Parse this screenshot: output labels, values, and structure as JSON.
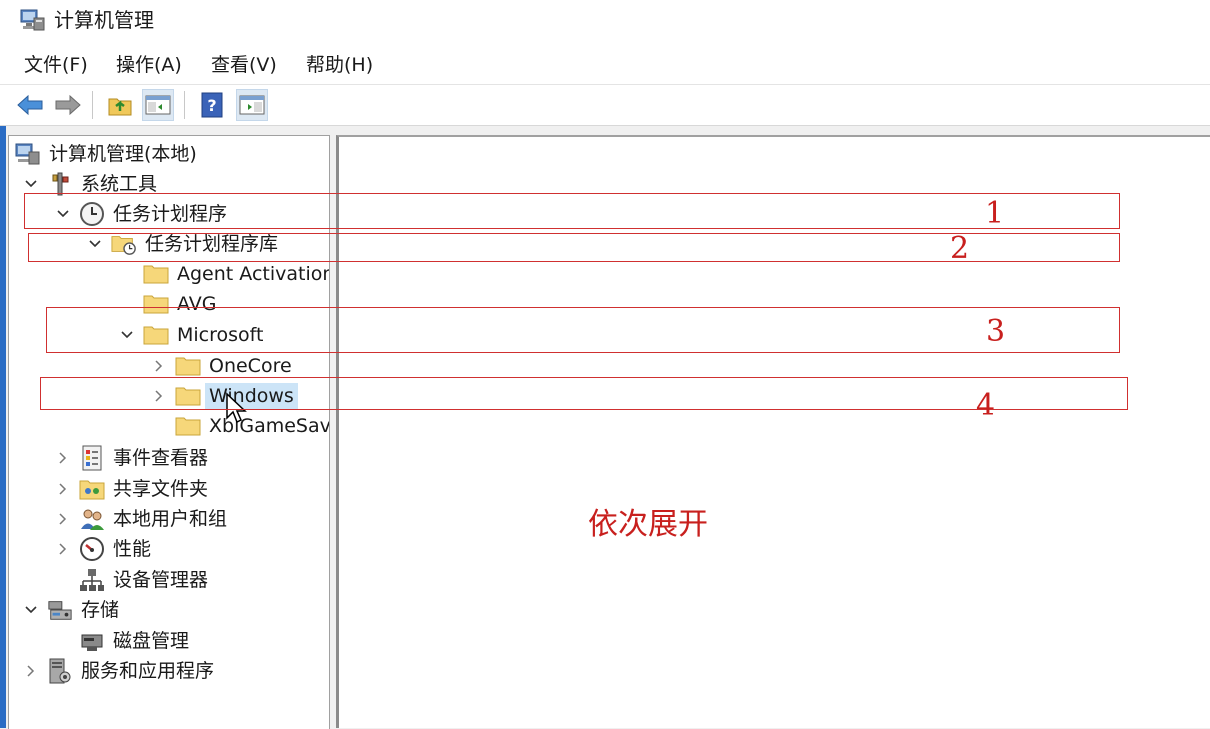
{
  "window": {
    "title": "计算机管理",
    "title_icon": "computer-management-icon"
  },
  "menu": {
    "items": [
      {
        "label": "文件(F)"
      },
      {
        "label": "操作(A)"
      },
      {
        "label": "查看(V)"
      },
      {
        "label": "帮助(H)"
      }
    ]
  },
  "toolbar": {
    "buttons": [
      {
        "icon": "back-arrow-icon"
      },
      {
        "icon": "forward-arrow-icon"
      },
      {
        "icon": "up-folder-icon"
      },
      {
        "icon": "show-hide-console-tree-icon"
      },
      {
        "icon": "help-icon"
      },
      {
        "icon": "show-hide-action-pane-icon"
      }
    ]
  },
  "tree": {
    "root": {
      "label": "计算机管理(本地)",
      "icon": "computer-management-icon"
    },
    "system_tools": {
      "label": "系统工具",
      "icon": "tools-icon"
    },
    "task_scheduler": {
      "label": "任务计划程序",
      "icon": "clock-icon"
    },
    "task_library": {
      "label": "任务计划程序库",
      "icon": "folder-clock-icon"
    },
    "agent_activation": {
      "label": "Agent Activation",
      "icon": "folder-icon"
    },
    "avg": {
      "label": "AVG",
      "icon": "folder-icon"
    },
    "microsoft": {
      "label": "Microsoft",
      "icon": "folder-icon"
    },
    "onecore": {
      "label": "OneCore",
      "icon": "folder-icon"
    },
    "windows": {
      "label": "Windows",
      "icon": "folder-icon"
    },
    "xblgamesave": {
      "label": "XblGameSave",
      "icon": "folder-icon"
    },
    "event_viewer": {
      "label": "事件查看器",
      "icon": "event-viewer-icon"
    },
    "shared_folders": {
      "label": "共享文件夹",
      "icon": "shared-folder-icon"
    },
    "local_users": {
      "label": "本地用户和组",
      "icon": "users-icon"
    },
    "performance": {
      "label": "性能",
      "icon": "performance-icon"
    },
    "device_manager": {
      "label": "设备管理器",
      "icon": "device-manager-icon"
    },
    "storage": {
      "label": "存储",
      "icon": "storage-icon"
    },
    "disk_management": {
      "label": "磁盘管理",
      "icon": "disk-icon"
    },
    "services_apps": {
      "label": "服务和应用程序",
      "icon": "services-icon"
    }
  },
  "annotations": {
    "numbers": [
      "1",
      "2",
      "3",
      "4"
    ],
    "caption": "依次展开",
    "color": "#c8201e"
  },
  "colors": {
    "selection": "#cce4f7",
    "folder": "#f6d77a"
  }
}
